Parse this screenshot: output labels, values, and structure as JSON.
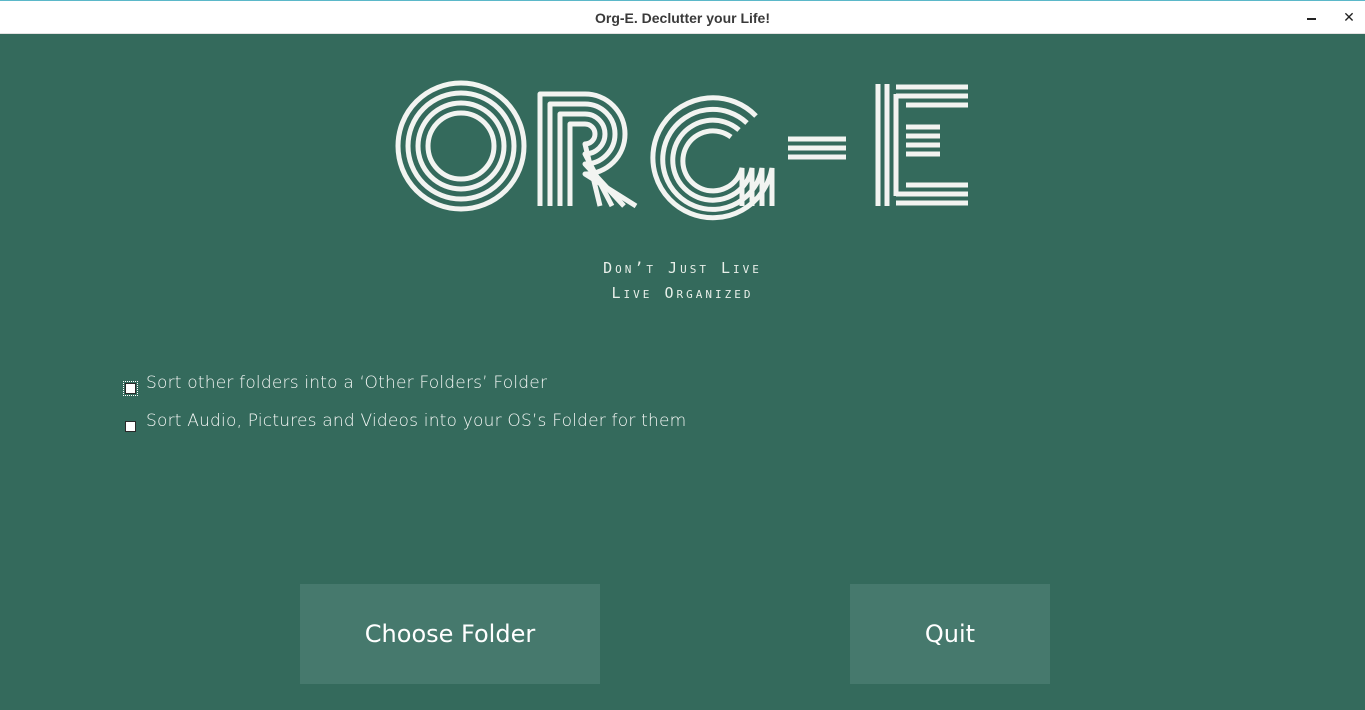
{
  "window": {
    "title": "Org-E. Declutter your Life!",
    "minimize_icon": "minimize-icon",
    "close_label": "✕"
  },
  "logo": {
    "text": "ORG-E",
    "color": "#f2f4f1"
  },
  "tagline": {
    "line1": "Don’t Just Live",
    "line2": "Live Organized"
  },
  "options": [
    {
      "label": "Sort other folders into a ‘Other Folders’ Folder",
      "checked": false
    },
    {
      "label": "Sort Audio, Pictures and Videos into your OS’s Folder for them",
      "checked": false
    }
  ],
  "buttons": {
    "choose_folder": "Choose Folder",
    "quit": "Quit"
  },
  "colors": {
    "background": "#346a5c",
    "button": "#46796d",
    "titlebar": "#ffffff"
  }
}
